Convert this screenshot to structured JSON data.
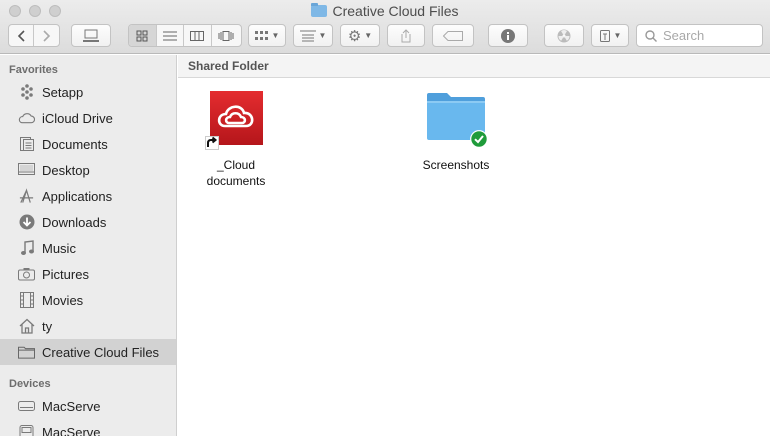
{
  "window": {
    "title": "Creative Cloud Files"
  },
  "toolbar": {
    "search_placeholder": "Search",
    "view_modes": [
      "icon-view",
      "list-view",
      "column-view",
      "cover-flow-view"
    ],
    "selected_view": "icon-view"
  },
  "sidebar": {
    "favorites_header": "Favorites",
    "favorites": [
      {
        "label": "Setapp",
        "icon": "setapp-icon"
      },
      {
        "label": "iCloud Drive",
        "icon": "cloud-icon"
      },
      {
        "label": "Documents",
        "icon": "document-icon"
      },
      {
        "label": "Desktop",
        "icon": "desktop-icon"
      },
      {
        "label": "Applications",
        "icon": "applications-icon"
      },
      {
        "label": "Downloads",
        "icon": "download-icon"
      },
      {
        "label": "Music",
        "icon": "music-icon"
      },
      {
        "label": "Pictures",
        "icon": "camera-icon"
      },
      {
        "label": "Movies",
        "icon": "film-icon"
      },
      {
        "label": "ty",
        "icon": "home-icon"
      },
      {
        "label": "Creative Cloud Files",
        "icon": "folder-icon",
        "selected": true
      }
    ],
    "devices_header": "Devices",
    "devices": [
      {
        "label": "MacServe",
        "icon": "drive-icon"
      },
      {
        "label": "MacServe",
        "icon": "drive-icon"
      }
    ]
  },
  "content": {
    "path_header": "Shared Folder",
    "items": [
      {
        "label": "_Cloud documents",
        "icon": "adobe-cc-alias-icon"
      },
      {
        "label": "Screenshots",
        "icon": "synced-folder-icon"
      }
    ]
  },
  "colors": {
    "adobe_red": "#d91e24",
    "folder_blue": "#5fb0ea",
    "sync_green": "#1f9b3a",
    "selection_gray": "#d2d2d2"
  }
}
